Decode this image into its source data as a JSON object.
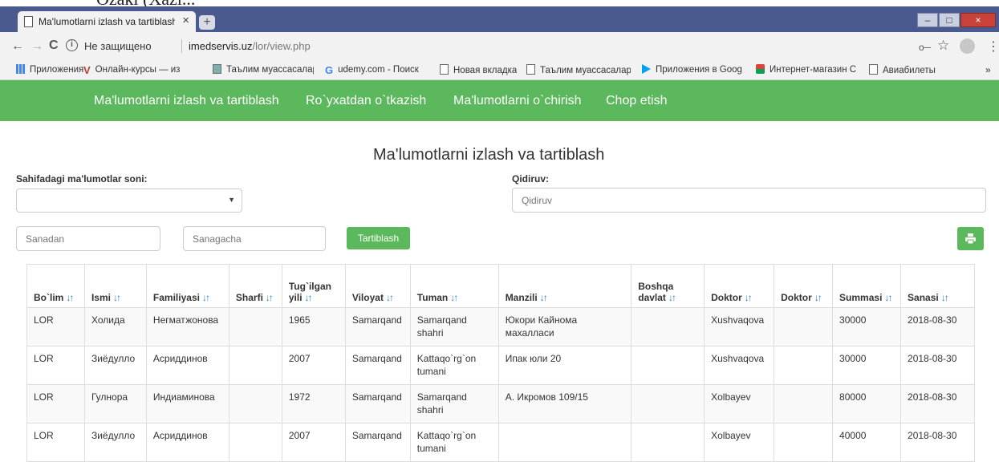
{
  "document_strip_text": "Ozaki (Xazi...",
  "browser": {
    "tab_title": "Ma'lumotlarni izlash va tartiblash",
    "tab_close": "×",
    "new_tab": "+",
    "window_controls": [
      "–",
      "□",
      "×"
    ],
    "nav": {
      "back": "←",
      "forward": "→",
      "reload": "C"
    },
    "security_label": "Не защищено",
    "url_host": "imedservis.uz",
    "url_path": "/lor/view.php",
    "bookmarks": [
      {
        "label": "Приложения",
        "icon": "apps-grid-icon"
      },
      {
        "label": "Онлайн-курсы — из",
        "icon": "course-logo-icon"
      },
      {
        "label": "Таълим муассасалар",
        "icon": "image-icon"
      },
      {
        "label": "udemy.com - Поиск",
        "icon": "google-icon"
      },
      {
        "label": "Новая вкладка",
        "icon": "page-icon"
      },
      {
        "label": "Таълим муассасалар",
        "icon": "page-icon"
      },
      {
        "label": "Приложения в Goog",
        "icon": "play-store-icon"
      },
      {
        "label": "Интернет-магазин С",
        "icon": "web-store-icon"
      },
      {
        "label": "Авиабилеты",
        "icon": "page-icon"
      }
    ],
    "bookmarks_more": "»"
  },
  "nav_menu": [
    "Ma'lumotlarni izlash va tartiblash",
    "Ro`yxatdan o`tkazish",
    "Ma'lumotlarni o`chirish",
    "Chop etish"
  ],
  "page": {
    "title": "Ma'lumotlarni izlash va tartiblash",
    "per_page_label": "Sahifadagi ma'lumotlar soni:",
    "per_page_value": "",
    "search_label": "Qidiruv:",
    "search_placeholder": "Qidiruv",
    "date_from_placeholder": "Sanadan",
    "date_to_placeholder": "Sanagacha",
    "sort_button": "Tartiblash",
    "colors": {
      "green": "#5cb85c",
      "sort_icon": "#337ab7"
    }
  },
  "table": {
    "headers": [
      "Bo`lim",
      "Ismi",
      "Familiyasi",
      "Sharfi",
      "Tug`ilgan yili",
      "Viloyat",
      "Tuman",
      "Manzili",
      "Boshqa davlat",
      "Doktor",
      "Doktor",
      "Summasi",
      "Sanasi"
    ],
    "sort_icon": "↓↑",
    "rows": [
      [
        "LOR",
        "Холида",
        "Негматжонова",
        "",
        "1965",
        "Samarqand",
        "Samarqand shahri",
        "Юкори Кайнома махалласи",
        "",
        "Xushvaqova",
        "",
        "30000",
        "2018-08-30"
      ],
      [
        "LOR",
        "Зиёдулло",
        "Асриддинов",
        "",
        "2007",
        "Samarqand",
        "Kattaqo`rg`on tumani",
        "Ипак юли 20",
        "",
        "Xushvaqova",
        "",
        "30000",
        "2018-08-30"
      ],
      [
        "LOR",
        "Гулнора",
        "Индиаминова",
        "",
        "1972",
        "Samarqand",
        "Samarqand shahri",
        "А. Икромов 109/15",
        "",
        "Xolbayev",
        "",
        "80000",
        "2018-08-30"
      ],
      [
        "LOR",
        "Зиёдулло",
        "Асриддинов",
        "",
        "2007",
        "Samarqand",
        "Kattaqo`rg`on tumani",
        "",
        "",
        "Xolbayev",
        "",
        "40000",
        "2018-08-30"
      ]
    ]
  }
}
